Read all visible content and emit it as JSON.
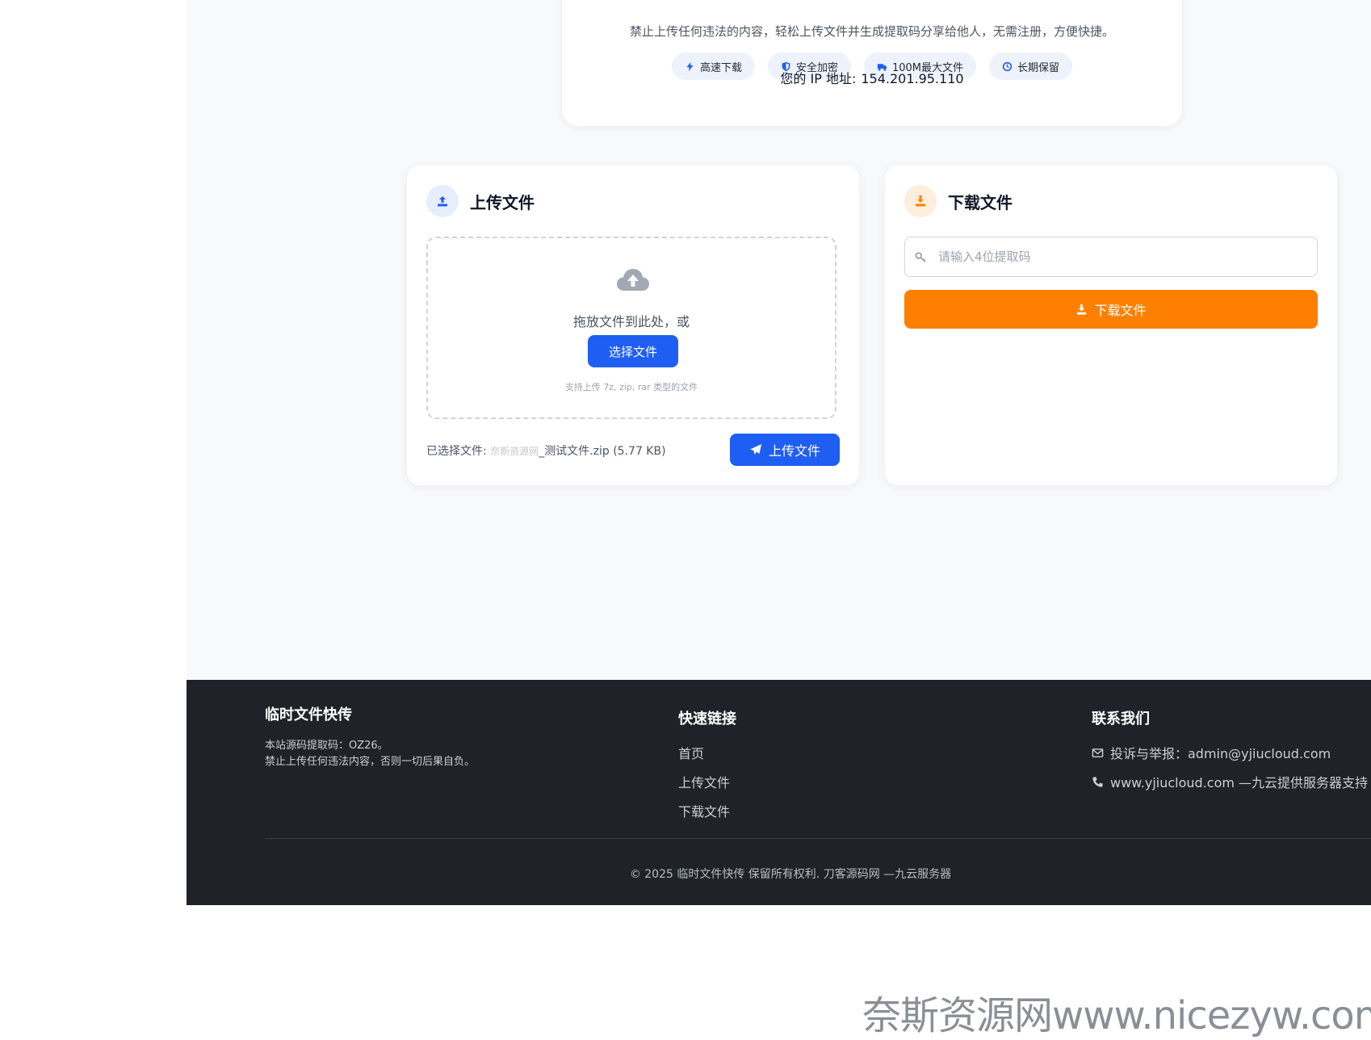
{
  "hero": {
    "description": "禁止上传任何违法的内容，轻松上传文件并生成提取码分享给他人，无需注册，方便快捷。",
    "features": [
      {
        "icon": "bolt-icon",
        "label": "高速下载"
      },
      {
        "icon": "shield-icon",
        "label": "安全加密"
      },
      {
        "icon": "truck-icon",
        "label": "100M最大文件"
      },
      {
        "icon": "clock-icon",
        "label": "长期保留"
      }
    ],
    "ip_label": "您的 IP 地址:",
    "ip_value": "154.201.95.110"
  },
  "upload": {
    "title": "上传文件",
    "drop_text": "拖放文件到此处，或",
    "choose_button": "选择文件",
    "hint": "支持上传 7z, zip, rar 类型的文件",
    "selected_label": "已选择文件:",
    "selected_watermark": "奈斯资源网",
    "selected_name": "_测试文件.zip (5.77 KB)",
    "submit_button": "上传文件"
  },
  "download": {
    "title": "下载文件",
    "input_placeholder": "请输入4位提取码",
    "input_value": "",
    "button": "下载文件"
  },
  "footer": {
    "about_title": "临时文件快传",
    "about_line1": "本站源码提取码：OZ26。",
    "about_line2": "禁止上传任何违法内容，否则一切后果自负。",
    "links_title": "快速链接",
    "links": [
      "首页",
      "上传文件",
      "下载文件"
    ],
    "contact_title": "联系我们",
    "contact_email": "投诉与举报：admin@yjiucloud.com",
    "contact_site": "www.yjiucloud.com —九云提供服务器支持",
    "copyright": "© 2025 临时文件快传 保留所有权利. 刀客源码网 —九云服务器"
  },
  "watermark": "奈斯资源网www.nicezyw.com",
  "colors": {
    "primary": "#1f5ef2",
    "orange": "#ff8000",
    "footer_bg": "#1f2329",
    "page_bg": "#f8f9fb"
  }
}
